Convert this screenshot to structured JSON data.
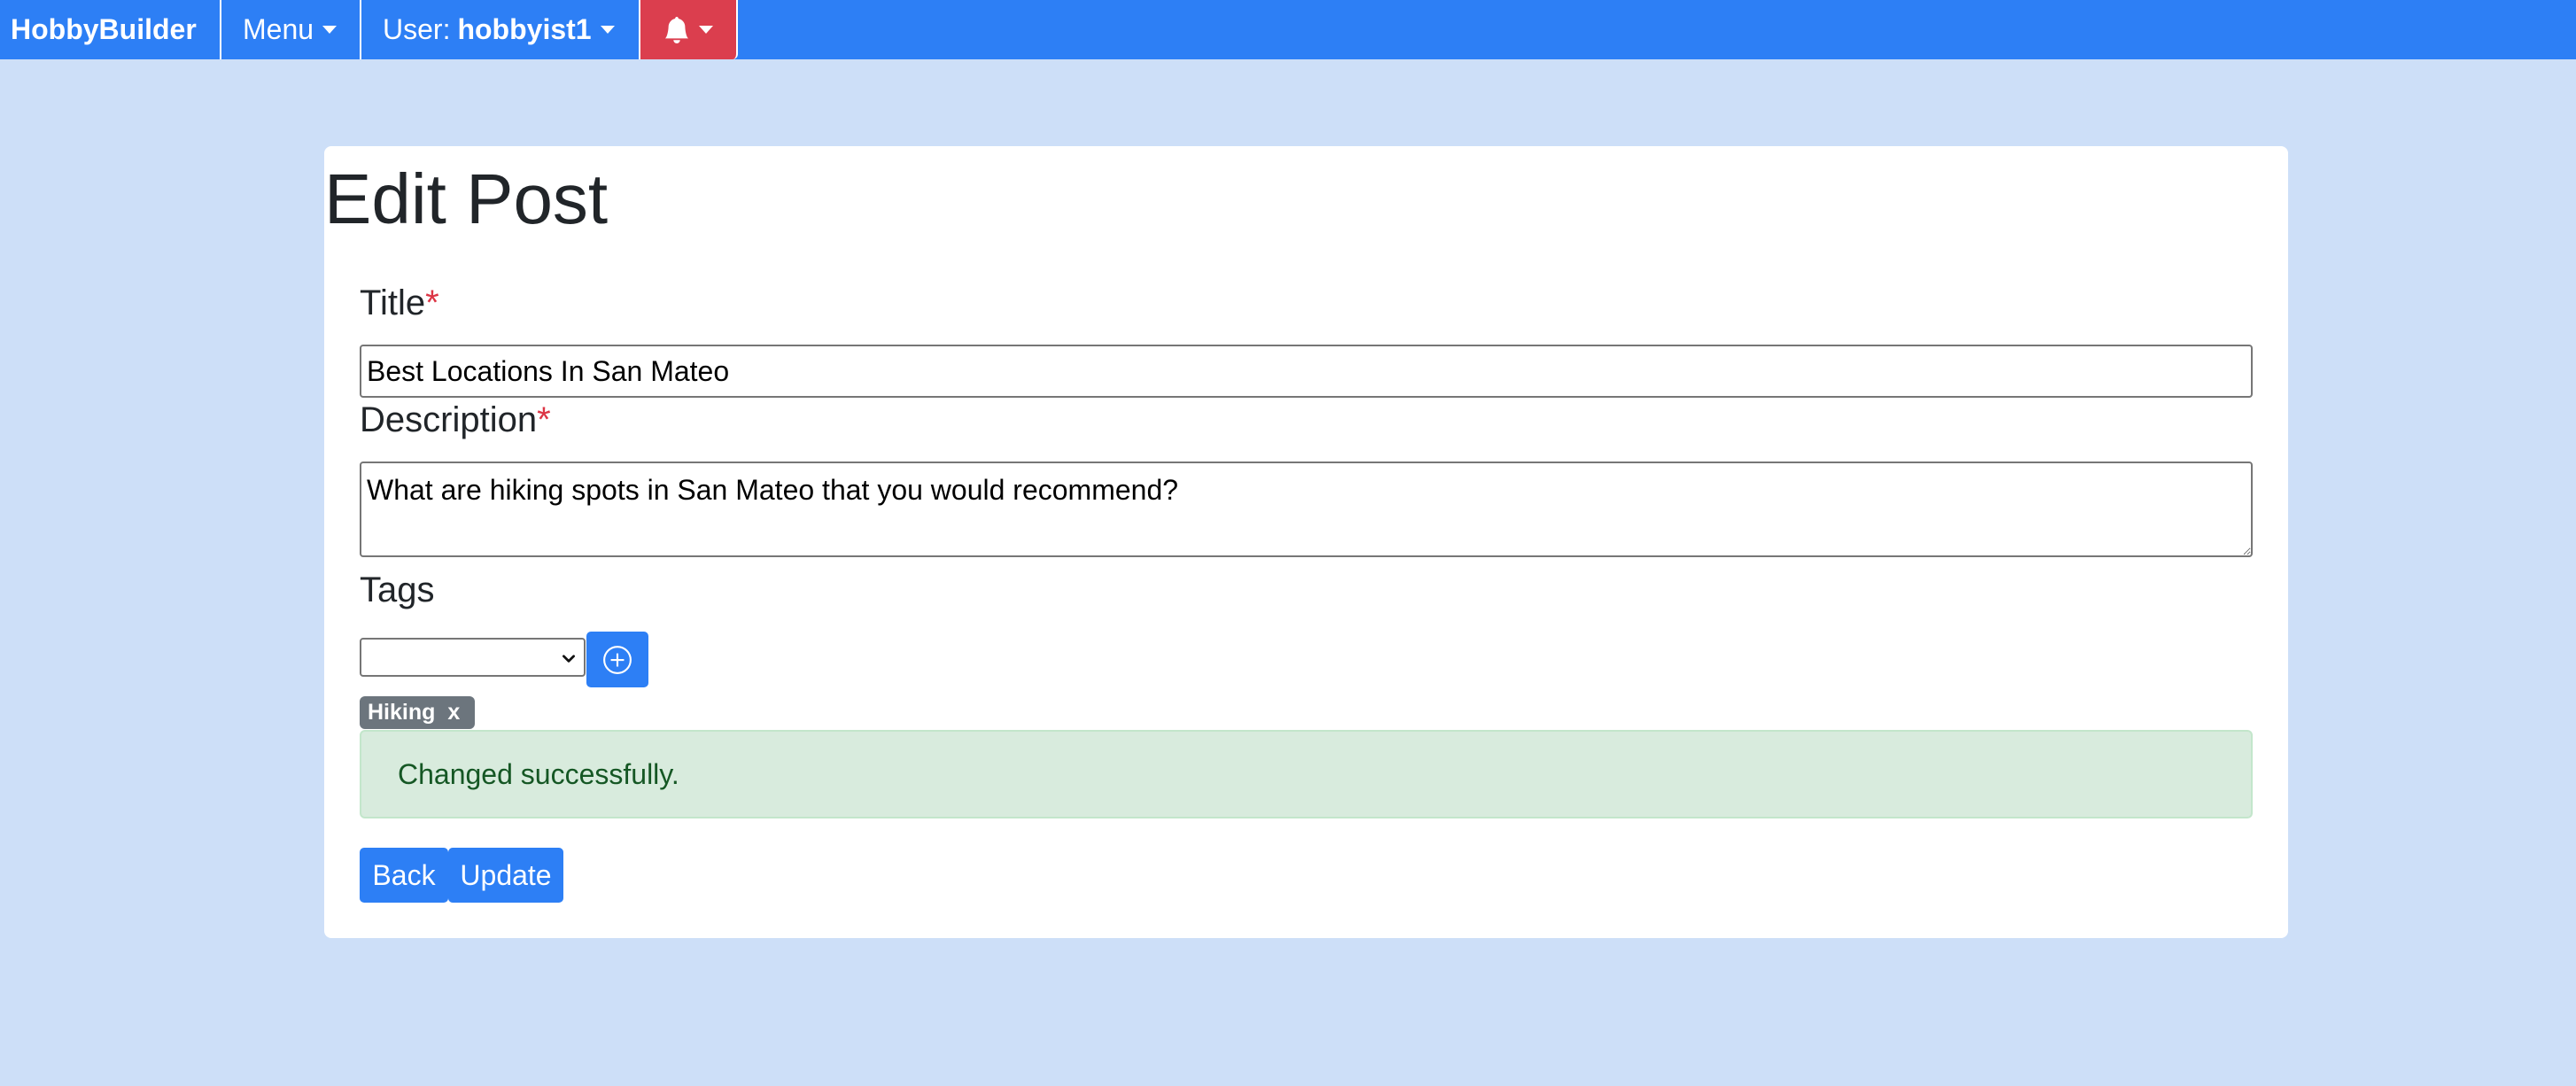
{
  "navbar": {
    "brand": "HobbyBuilder",
    "menu_label": "Menu",
    "user_prefix": "User:",
    "username": "hobbyist1",
    "notifications_icon": "bell-icon"
  },
  "colors": {
    "primary": "#2d7ff5",
    "danger": "#db3e4e",
    "page_bg": "#cddff8",
    "success_bg": "#d8ebdd",
    "success_text": "#155724",
    "tag_bg": "#6c757d"
  },
  "form": {
    "heading": "Edit Post",
    "required_marker": "*",
    "title_label": "Title",
    "title_value": "Best Locations In San Mateo",
    "description_label": "Description",
    "description_value": "What are hiking spots in San Mateo that you would recommend?",
    "tags_label": "Tags",
    "tag_select_value": "",
    "add_tag_icon": "plus-circle-icon",
    "tags": [
      {
        "label": "Hiking",
        "remove_label": "x"
      }
    ],
    "success_message": "Changed successfully.",
    "back_label": "Back",
    "update_label": "Update"
  }
}
